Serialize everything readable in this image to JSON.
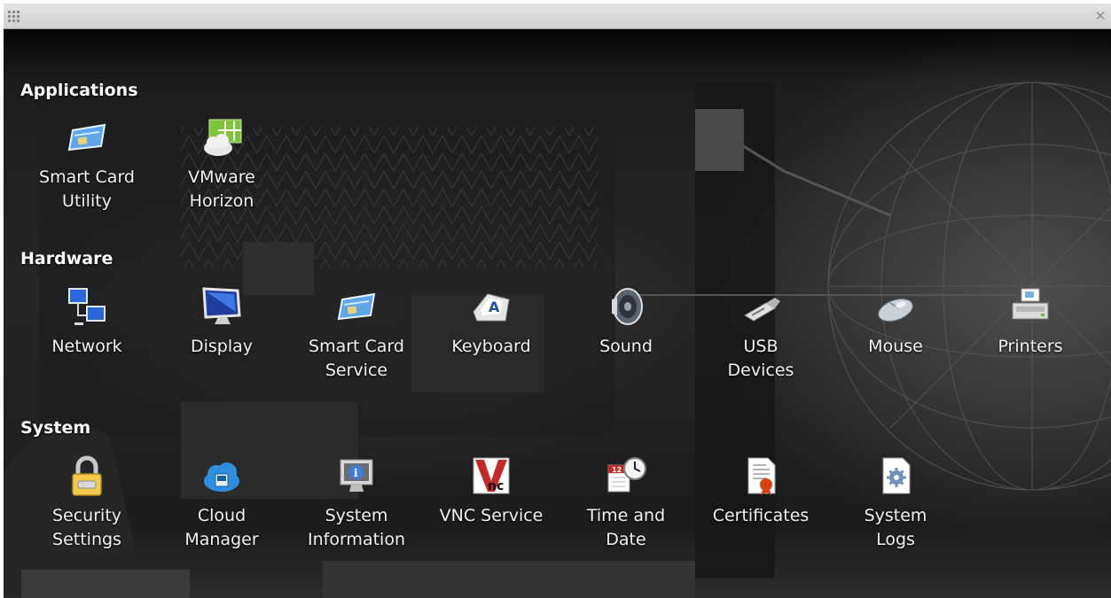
{
  "window": {
    "grip_icon": "grip-icon",
    "close_icon": "close-icon",
    "close_glyph": "✕"
  },
  "sections": {
    "applications": {
      "title": "Applications",
      "items": [
        {
          "label": "Smart Card\nUtility",
          "icon": "smart-card-icon"
        },
        {
          "label": "VMware\nHorizon",
          "icon": "vmware-horizon-icon"
        }
      ]
    },
    "hardware": {
      "title": "Hardware",
      "items": [
        {
          "label": "Network",
          "icon": "network-icon"
        },
        {
          "label": "Display",
          "icon": "display-icon"
        },
        {
          "label": "Smart Card\nService",
          "icon": "smart-card-icon"
        },
        {
          "label": "Keyboard",
          "icon": "keyboard-icon"
        },
        {
          "label": "Sound",
          "icon": "speaker-icon"
        },
        {
          "label": "USB\nDevices",
          "icon": "usb-icon"
        },
        {
          "label": "Mouse",
          "icon": "mouse-icon"
        },
        {
          "label": "Printers",
          "icon": "printer-icon"
        }
      ]
    },
    "system": {
      "title": "System",
      "items": [
        {
          "label": "Security\nSettings",
          "icon": "lock-icon"
        },
        {
          "label": "Cloud\nManager",
          "icon": "cloud-icon"
        },
        {
          "label": "System\nInformation",
          "icon": "info-monitor-icon"
        },
        {
          "label": "VNC Service",
          "icon": "vnc-icon"
        },
        {
          "label": "Time and\nDate",
          "icon": "clock-calendar-icon"
        },
        {
          "label": "Certificates",
          "icon": "certificate-icon"
        },
        {
          "label": "System\nLogs",
          "icon": "gear-document-icon"
        }
      ]
    }
  }
}
